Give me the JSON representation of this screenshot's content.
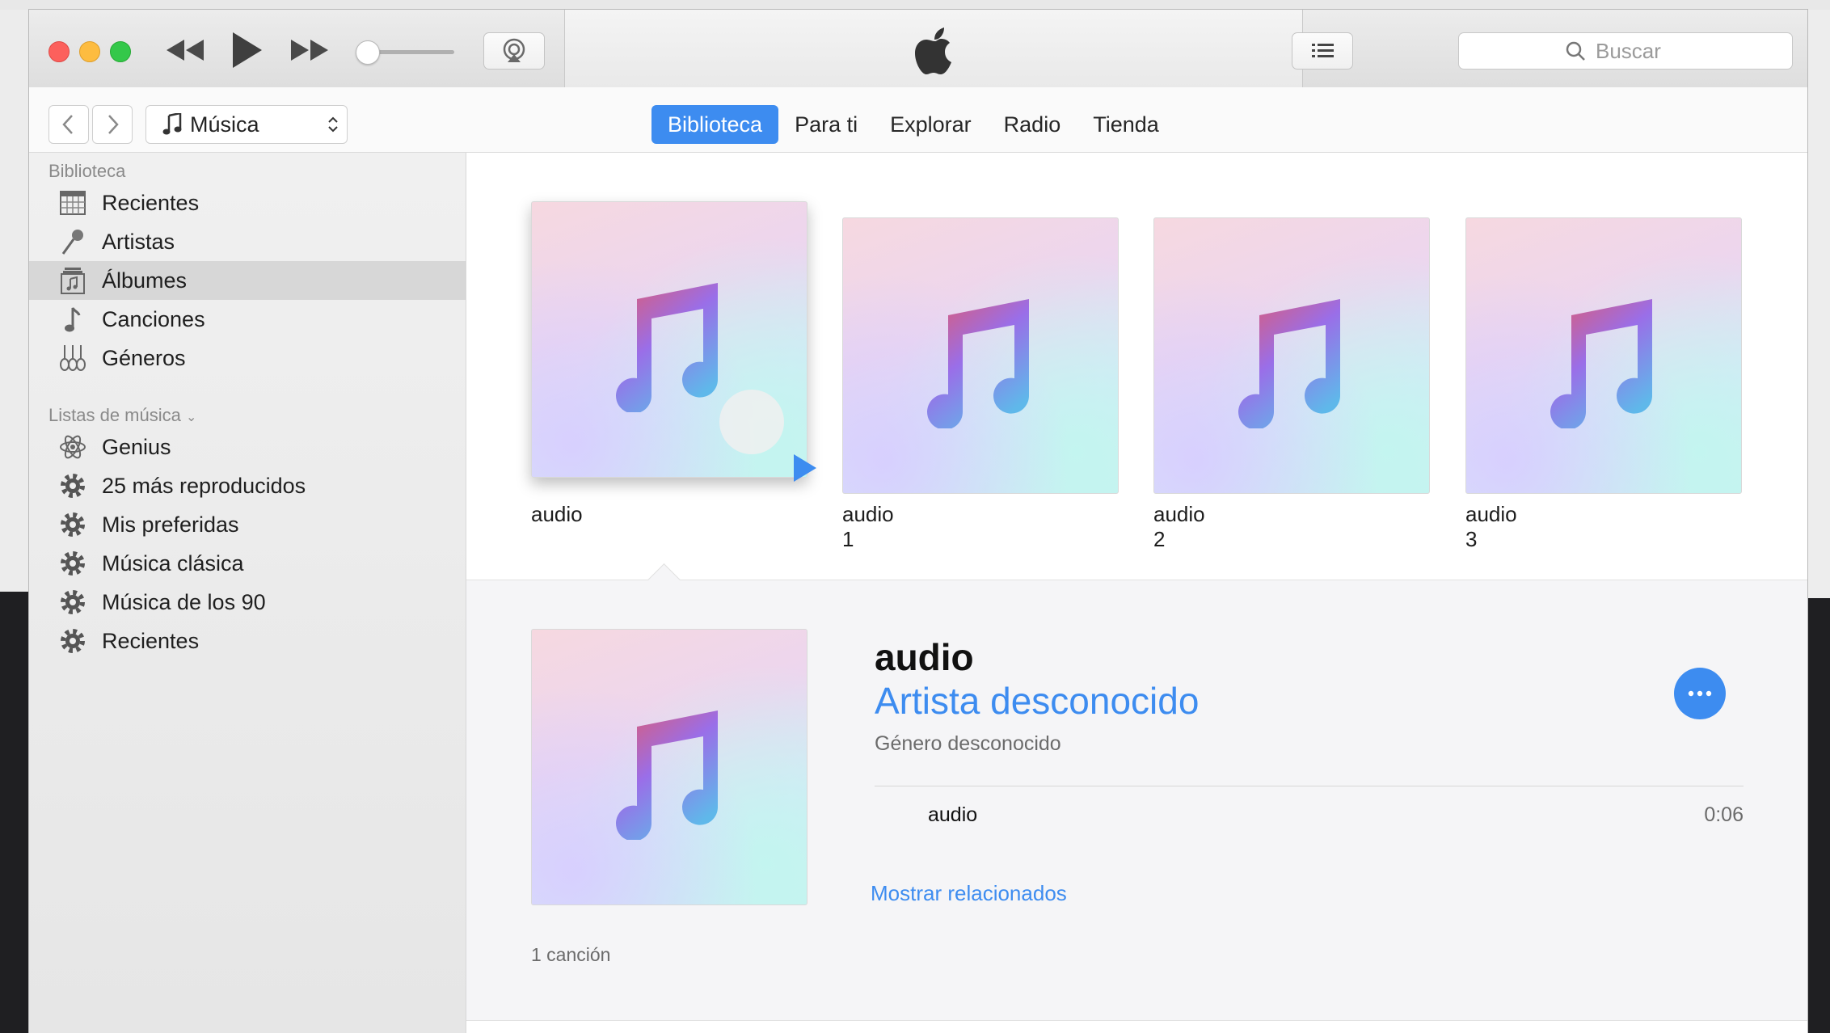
{
  "toolbar": {
    "rewind_icon": "rewind-icon",
    "play_icon": "play-icon",
    "fast_forward_icon": "fast-forward-icon",
    "volume_level": 0.05,
    "airplay_icon": "airplay-icon",
    "apple_logo": "apple-logo",
    "list_view_icon": "list-icon",
    "search_placeholder": "Buscar"
  },
  "nav": {
    "source": "Música",
    "tabs": [
      {
        "label": "Biblioteca",
        "active": true
      },
      {
        "label": "Para ti",
        "active": false
      },
      {
        "label": "Explorar",
        "active": false
      },
      {
        "label": "Radio",
        "active": false
      },
      {
        "label": "Tienda",
        "active": false
      }
    ]
  },
  "sidebar": {
    "library_header": "Biblioteca",
    "library_items": [
      {
        "label": "Recientes",
        "icon": "calendar-grid-icon"
      },
      {
        "label": "Artistas",
        "icon": "microphone-icon"
      },
      {
        "label": "Álbumes",
        "icon": "album-icon",
        "selected": true
      },
      {
        "label": "Canciones",
        "icon": "music-note-icon"
      },
      {
        "label": "Géneros",
        "icon": "guitars-icon"
      }
    ],
    "playlists_header": "Listas de música",
    "playlist_items": [
      {
        "label": "Genius",
        "icon": "genius-atom-icon"
      },
      {
        "label": "25 más reproducidos",
        "icon": "gear-icon"
      },
      {
        "label": "Mis preferidas",
        "icon": "gear-icon"
      },
      {
        "label": "Música clásica",
        "icon": "gear-icon"
      },
      {
        "label": "Música de los 90",
        "icon": "gear-icon"
      },
      {
        "label": "Recientes",
        "icon": "gear-icon"
      }
    ]
  },
  "albums": [
    {
      "title": "audio"
    },
    {
      "title": "audio 1"
    },
    {
      "title": "audio 2"
    },
    {
      "title": "audio 3"
    }
  ],
  "detail": {
    "title": "audio",
    "artist": "Artista desconocido",
    "genre": "Género desconocido",
    "tracks": [
      {
        "name": "audio",
        "duration": "0:06"
      }
    ],
    "show_related": "Mostrar relacionados",
    "song_count": "1 canción"
  },
  "colors": {
    "accent": "#3d8cf0"
  }
}
